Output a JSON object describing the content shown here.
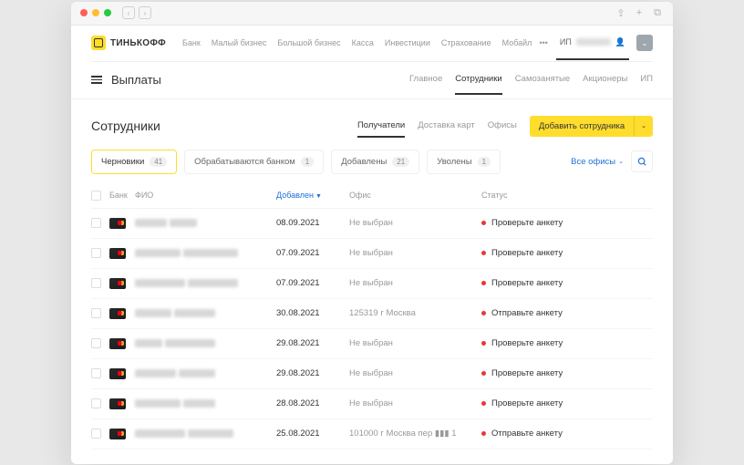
{
  "brand": "ТИНЬКОФФ",
  "topNav": [
    "Банк",
    "Малый бизнес",
    "Большой бизнес",
    "Касса",
    "Инвестиции",
    "Страхование",
    "Мобайл"
  ],
  "userPrefix": "ИП",
  "pageTitle": "Выплаты",
  "subTabs": [
    {
      "label": "Главное",
      "active": false
    },
    {
      "label": "Сотрудники",
      "active": true
    },
    {
      "label": "Самозанятые",
      "active": false
    },
    {
      "label": "Акционеры",
      "active": false
    },
    {
      "label": "ИП",
      "active": false
    }
  ],
  "sectionTitle": "Сотрудники",
  "sectionTabs": [
    {
      "label": "Получатели",
      "active": true
    },
    {
      "label": "Доставка карт",
      "active": false
    },
    {
      "label": "Офисы",
      "active": false
    }
  ],
  "addButton": "Добавить сотрудника",
  "chips": [
    {
      "label": "Черновики",
      "count": "41",
      "active": true
    },
    {
      "label": "Обрабатываются банком",
      "count": "1",
      "active": false
    },
    {
      "label": "Добавлены",
      "count": "21",
      "active": false
    },
    {
      "label": "Уволены",
      "count": "1",
      "active": false
    }
  ],
  "officeFilter": "Все офисы",
  "columns": {
    "bank": "Банк",
    "fio": "ФИО",
    "date": "Добавлен",
    "office": "Офис",
    "status": "Статус"
  },
  "rows": [
    {
      "date": "08.09.2021",
      "office": "Не выбран",
      "status": "Проверьте анкету",
      "w1": 35,
      "w2": 30
    },
    {
      "date": "07.09.2021",
      "office": "Не выбран",
      "status": "Проверьте анкету",
      "w1": 50,
      "w2": 60
    },
    {
      "date": "07.09.2021",
      "office": "Не выбран",
      "status": "Проверьте анкету",
      "w1": 55,
      "w2": 55
    },
    {
      "date": "30.08.2021",
      "office": "125319 г Москва",
      "status": "Отправьте анкету",
      "w1": 40,
      "w2": 45
    },
    {
      "date": "29.08.2021",
      "office": "Не выбран",
      "status": "Проверьте анкету",
      "w1": 30,
      "w2": 55
    },
    {
      "date": "29.08.2021",
      "office": "Не выбран",
      "status": "Проверьте анкету",
      "w1": 45,
      "w2": 40
    },
    {
      "date": "28.08.2021",
      "office": "Не выбран",
      "status": "Проверьте анкету",
      "w1": 50,
      "w2": 35
    },
    {
      "date": "25.08.2021",
      "office": "101000 г Москва пер ▮▮▮ 1",
      "status": "Отправьте анкету",
      "w1": 55,
      "w2": 50
    }
  ]
}
